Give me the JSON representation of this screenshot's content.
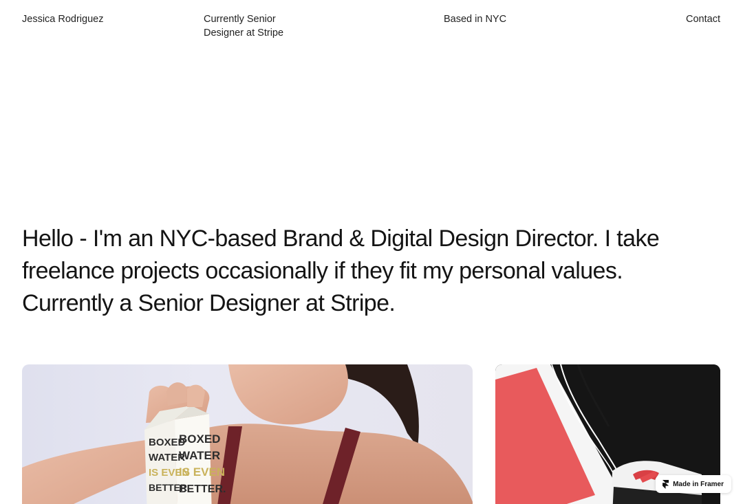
{
  "header": {
    "name": "Jessica Rodriguez",
    "role": "Currently Senior Designer at Stripe",
    "location": "Based in NYC",
    "contact": "Contact"
  },
  "hero": {
    "text": "Hello - I'm an NYC-based Brand & Digital Design Director. I take freelance projects occasionally if they fit my personal values. Currently a Senior Designer at Stripe."
  },
  "project_left": {
    "carton_front": [
      "BOXED",
      "WATER",
      "IS EVEN",
      "BETTER."
    ],
    "carton_side": [
      "BOXED",
      "WATER",
      "IS EVEN",
      "BETTER."
    ]
  },
  "badge": {
    "label": "Made in Framer",
    "icon": "framer-logo-icon"
  },
  "colors": {
    "background": "#ffffff",
    "text": "#141414",
    "tank_top": "#6e2229",
    "accent_red": "#e85a5c"
  }
}
